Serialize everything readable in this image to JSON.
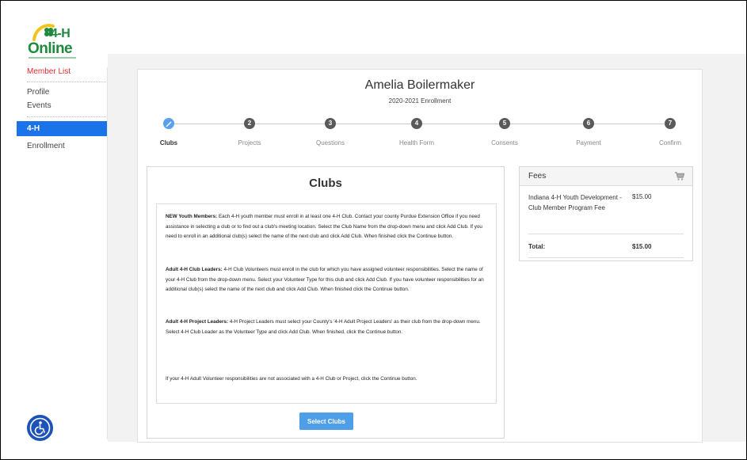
{
  "brand": {
    "line1": "4-H",
    "line2": "Online"
  },
  "sidebar": {
    "items": [
      {
        "label": "Member List",
        "style": "red"
      },
      {
        "label": "Profile",
        "style": "gray"
      },
      {
        "label": "Events",
        "style": "gray"
      },
      {
        "label": "4-H",
        "style": "active"
      },
      {
        "label": "Enrollment",
        "style": "gray"
      }
    ]
  },
  "member": {
    "name": "Amelia Boilermaker",
    "enrollment": "2020-2021 Enrollment"
  },
  "steps": [
    {
      "number": "",
      "label": "Clubs",
      "state": "done",
      "icon": "pencil-icon"
    },
    {
      "number": "2",
      "label": "Projects",
      "state": "todo"
    },
    {
      "number": "3",
      "label": "Questions",
      "state": "todo"
    },
    {
      "number": "4",
      "label": "Health Form",
      "state": "todo"
    },
    {
      "number": "5",
      "label": "Consents",
      "state": "todo"
    },
    {
      "number": "6",
      "label": "Payment",
      "state": "todo"
    },
    {
      "number": "7",
      "label": "Confirm",
      "state": "todo"
    }
  ],
  "clubs": {
    "title": "Clubs",
    "paragraphs": [
      {
        "lead": "NEW Youth Members:",
        "text": " Each 4-H youth member must enroll in at least one 4-H Club.  Contact your county Purdue Extension Office if you need assistance in selecting a club or to find out a club's meeting location.  Select the Club Name from the drop-down menu and click Add Club.  If you need to enroll in an additional club(s) select the name of the next club and click Add Club. When finished click the Continue button."
      },
      {
        "lead": "Adult 4-H Club Leaders:",
        "text": " 4-H Club Volunteers must enroll in the club for which you have assigned volunteer responsibilities. Select the name of your 4-H Club from the drop-down menu.  Select your Volunteer Type for this club and click Add Club.  If you have volunteer responsibilities for an additional club(s) select the name of the next club and click Add Club. When finished click the Continue button."
      },
      {
        "lead": "Adult 4-H Project Leaders:",
        "text": " 4-H Project Leaders must select your County's '4-H Adult Project Leaders' as their club from the drop-down menu.  Select 4-H Club Leader as the Volunteer Type and click Add Club.  When finished, click the Continue button."
      },
      {
        "lead": "",
        "text": "If your 4-H Adult Volunteer responsibilities are not associated with a 4-H Club or Project, click the Continue button."
      }
    ],
    "button_label": "Select Clubs"
  },
  "fees": {
    "title": "Fees",
    "item_desc": "Indiana 4-H Youth Development - Club Member Program Fee",
    "item_amount": "$15.00",
    "total_label": "Total:",
    "total_amount": "$15.00"
  },
  "colors": {
    "accent": "#1a73e8",
    "step_done": "#5aa0f0",
    "brand_green": "#1d8a3c",
    "member_list_red": "#e0282e"
  },
  "icons": {
    "cart": "cart-icon",
    "accessibility": "accessibility-icon",
    "logo": "clover-logo-icon"
  }
}
